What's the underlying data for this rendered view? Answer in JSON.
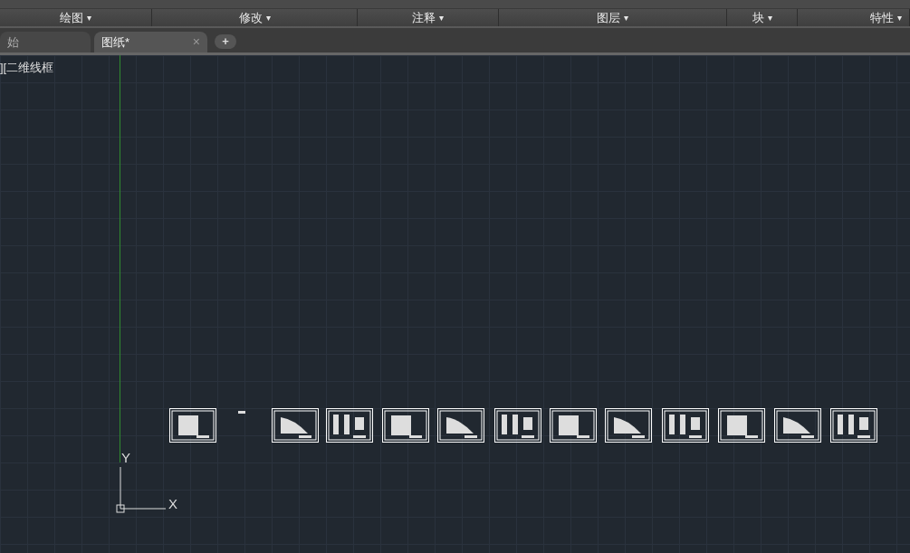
{
  "ribbon_panels": [
    {
      "label": "绘图",
      "caret": "▾"
    },
    {
      "label": "修改",
      "caret": "▾"
    },
    {
      "label": "注释",
      "caret": "▾"
    },
    {
      "label": "图层",
      "caret": "▾"
    },
    {
      "label": "块",
      "caret": "▾"
    },
    {
      "label": "特性",
      "caret": "▾"
    }
  ],
  "tabs": [
    {
      "label": "始",
      "selected": false
    },
    {
      "label": "图纸*",
      "selected": true,
      "close": "×"
    }
  ],
  "new_tab": "+",
  "viewport_label": "][二维线框",
  "ucs": {
    "y": "Y",
    "x": "X"
  }
}
